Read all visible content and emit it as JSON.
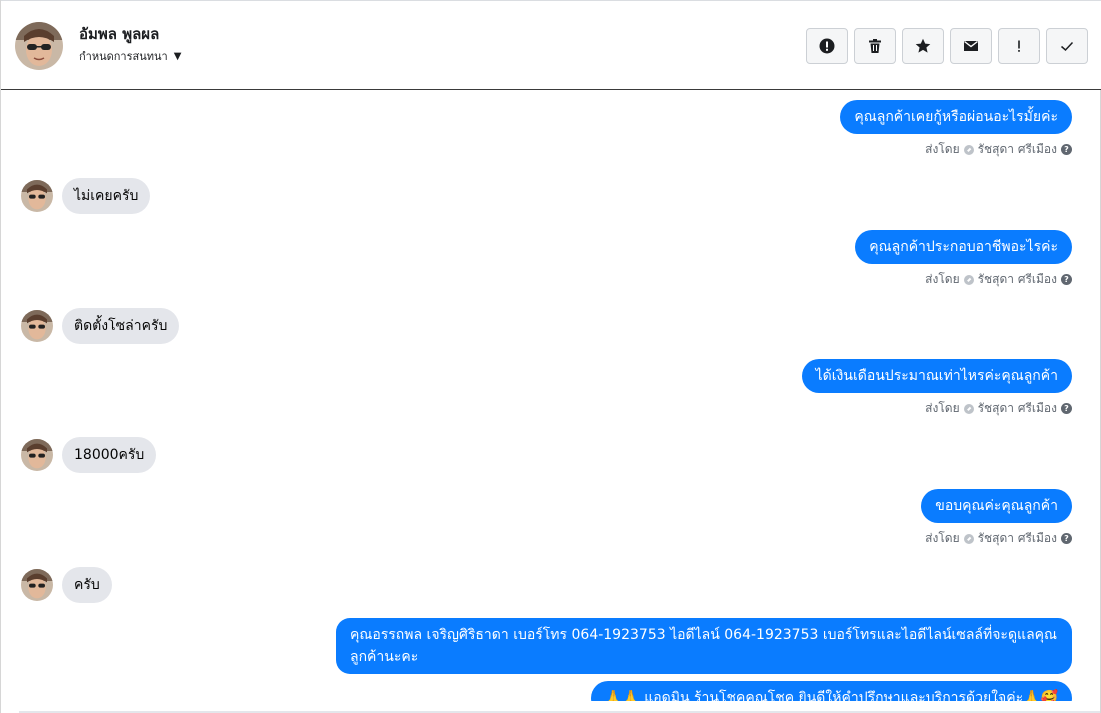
{
  "header": {
    "contact_name": "อัมพล พูลผล",
    "assign_label": "กำหนดการสนทนา"
  },
  "actions": [
    {
      "icon": "alert-circle-icon"
    },
    {
      "icon": "trash-icon"
    },
    {
      "icon": "star-icon"
    },
    {
      "icon": "mail-icon"
    },
    {
      "icon": "exclamation-icon"
    },
    {
      "icon": "check-icon"
    }
  ],
  "sender": {
    "prefix": "ส่งโดย",
    "name": "รัชสุดา ศรีเมือง",
    "help": "?"
  },
  "messages": [
    {
      "dir": "out",
      "text": "คุณลูกค้าเคยกู้หรือผ่อนอะไรมั้ยค่ะ"
    },
    {
      "dir": "in",
      "text": "ไม่เคยครับ"
    },
    {
      "dir": "out",
      "text": "คุณลูกค้าประกอบอาชีพอะไรค่ะ"
    },
    {
      "dir": "in",
      "text": "ติดตั้งโซล่าครับ"
    },
    {
      "dir": "out",
      "text": "ได้เงินเดือนประมาณเท่าไหรค่ะคุณลูกค้า"
    },
    {
      "dir": "in",
      "text": "18000ครับ"
    },
    {
      "dir": "out",
      "text": "ขอบคุณค่ะคุณลูกค้า"
    },
    {
      "dir": "in",
      "text": "ครับ"
    },
    {
      "dir": "out",
      "text": "คุณอรรถพล เจริญศิริธาดา      เบอร์โทร 064-1923753 ไอดีไลน์ 064-1923753   เบอร์โทรและไอดีไลน์เซลล์ที่จะดูแลคุณลูกค้านะคะ"
    },
    {
      "dir": "out",
      "text": "🙏🙏 แอดมิน ร้านโชคคูณโชค ยินดีให้คำปรึกษาและบริการด้วยใจค่ะ🙏🥰"
    }
  ]
}
